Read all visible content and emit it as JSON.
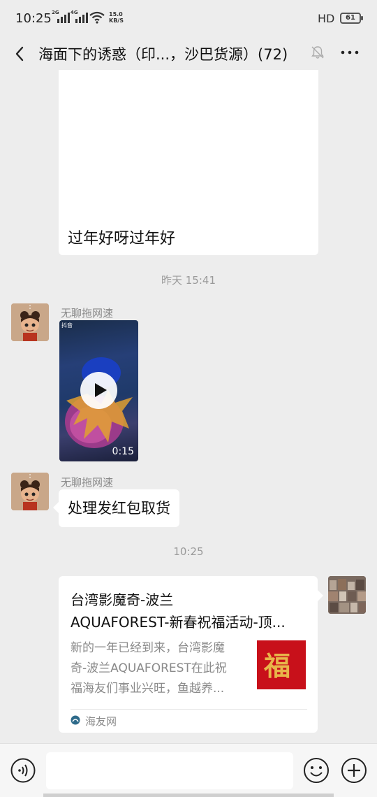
{
  "status_bar": {
    "time": "10:25",
    "signal_1_tag": "2G",
    "signal_2_tag": "4G",
    "net_speed_value": "15.0",
    "net_speed_unit": "KB/S",
    "hd_label": "HD",
    "battery_level": "61"
  },
  "header": {
    "title": "海面下的诱惑（印...，沙巴货源）(72)",
    "icons": [
      "back-icon",
      "mute-bell-icon",
      "more-icon"
    ]
  },
  "messages": {
    "top_bubble_text": "过年好呀过年好",
    "timestamp_1": "昨天 15:41",
    "video_sender": "无聊拖网速",
    "video_logo": "抖音",
    "video_duration": "0:15",
    "text_sender": "无聊拖网速",
    "text_message": "处理发红包取货",
    "timestamp_2": "10:25",
    "link_card": {
      "title_line_1": "台湾影魔奇-波兰",
      "title_line_2": "AQUAFOREST-新春祝福活动-顶...",
      "desc_line_1": "新的一年已经到来，台湾影魔",
      "desc_line_2": "奇-波兰AQUAFOREST在此祝",
      "desc_line_3": "福海友们事业兴旺，鱼越养...",
      "thumb_char": "福",
      "source": "海友网"
    }
  },
  "input_bar": {
    "placeholder": "",
    "icons": [
      "voice-icon",
      "emoji-icon",
      "plus-icon"
    ]
  },
  "colors": {
    "background": "#ededed",
    "bubble": "#ffffff",
    "thumb_red": "#c8101a"
  }
}
